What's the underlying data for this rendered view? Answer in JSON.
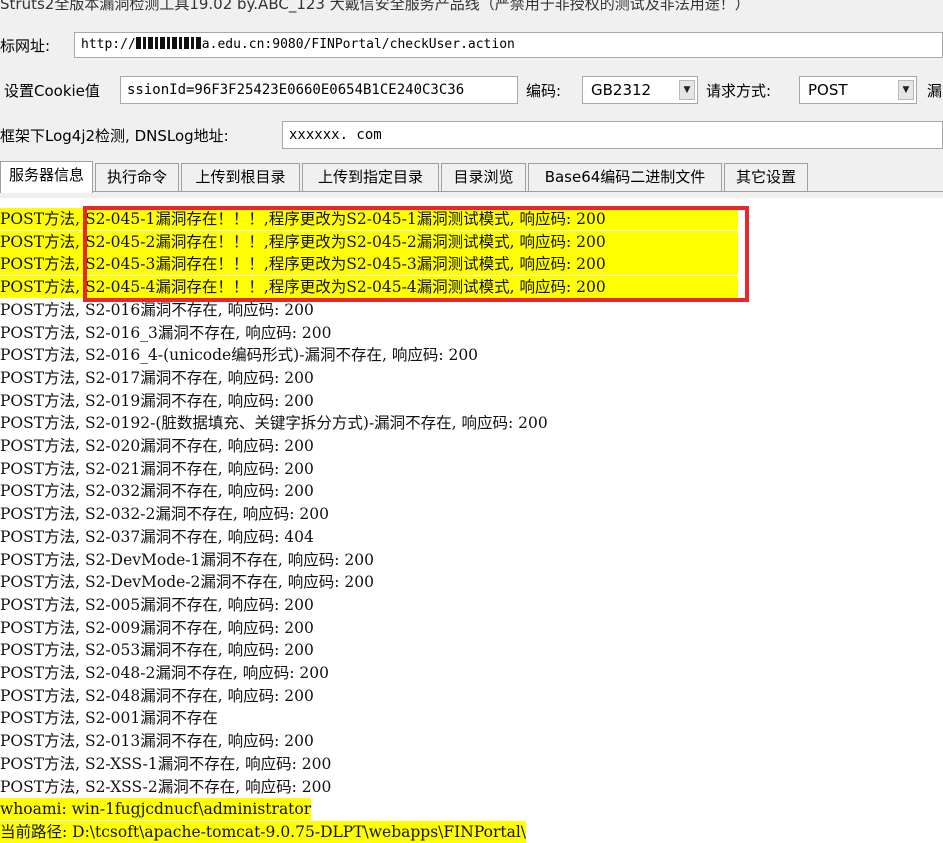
{
  "window": {
    "title": "Struts2全版本漏洞检测工具19.02 by.ABC_123 大戴信安全服务产品线（严禁用于非授权的测试及非法用途！）"
  },
  "form": {
    "url_label": "标网址:",
    "url_prefix": "http://",
    "url_suffix": "a.edu.cn:9080/FINPortal/checkUser.action",
    "cookie_label": "设置Cookie值",
    "cookie_value": "ssionId=96F3F25423E0660E0654B1CE240C3C36",
    "encoding_label": "编码:",
    "encoding_value": "GB2312",
    "method_label": "请求方式:",
    "method_value": "POST",
    "truncated_label": "漏",
    "dnslog_label": "框架下Log4j2检测, DNSLog地址:",
    "dnslog_value": "xxxxxx. com"
  },
  "tabs": [
    {
      "label": "服务器信息"
    },
    {
      "label": "执行命令"
    },
    {
      "label": "上传到根目录"
    },
    {
      "label": "上传到指定目录"
    },
    {
      "label": "目录浏览"
    },
    {
      "label": "Base64编码二进制文件"
    },
    {
      "label": "其它设置"
    }
  ],
  "log": [
    {
      "text": "POST方法, S2-045-1漏洞存在！！！,程序更改为S2-045-1漏洞测试模式, 响应码: 200",
      "highlight": true
    },
    {
      "text": "POST方法, S2-045-2漏洞存在！！！,程序更改为S2-045-2漏洞测试模式, 响应码: 200",
      "highlight": true
    },
    {
      "text": "POST方法, S2-045-3漏洞存在！！！,程序更改为S2-045-3漏洞测试模式, 响应码: 200",
      "highlight": true
    },
    {
      "text": "POST方法, S2-045-4漏洞存在！！！,程序更改为S2-045-4漏洞测试模式, 响应码: 200",
      "highlight": true
    },
    {
      "text": "POST方法, S2-016漏洞不存在, 响应码: 200",
      "highlight": false
    },
    {
      "text": "POST方法, S2-016_3漏洞不存在, 响应码: 200",
      "highlight": false
    },
    {
      "text": "POST方法, S2-016_4-(unicode编码形式)-漏洞不存在, 响应码: 200",
      "highlight": false
    },
    {
      "text": "POST方法, S2-017漏洞不存在, 响应码: 200",
      "highlight": false
    },
    {
      "text": "POST方法, S2-019漏洞不存在, 响应码: 200",
      "highlight": false
    },
    {
      "text": "POST方法, S2-0192-(脏数据填充、关键字拆分方式)-漏洞不存在, 响应码: 200",
      "highlight": false
    },
    {
      "text": "POST方法, S2-020漏洞不存在, 响应码: 200",
      "highlight": false
    },
    {
      "text": "POST方法, S2-021漏洞不存在, 响应码: 200",
      "highlight": false
    },
    {
      "text": "POST方法, S2-032漏洞不存在, 响应码: 200",
      "highlight": false
    },
    {
      "text": "POST方法, S2-032-2漏洞不存在, 响应码: 200",
      "highlight": false
    },
    {
      "text": "POST方法, S2-037漏洞不存在, 响应码: 404",
      "highlight": false
    },
    {
      "text": "POST方法, S2-DevMode-1漏洞不存在, 响应码: 200",
      "highlight": false
    },
    {
      "text": "POST方法, S2-DevMode-2漏洞不存在, 响应码: 200",
      "highlight": false
    },
    {
      "text": "POST方法, S2-005漏洞不存在, 响应码: 200",
      "highlight": false
    },
    {
      "text": "POST方法, S2-009漏洞不存在, 响应码: 200",
      "highlight": false
    },
    {
      "text": "POST方法, S2-053漏洞不存在, 响应码: 200",
      "highlight": false
    },
    {
      "text": "POST方法, S2-048-2漏洞不存在, 响应码: 200",
      "highlight": false
    },
    {
      "text": "POST方法, S2-048漏洞不存在, 响应码: 200",
      "highlight": false
    },
    {
      "text": "POST方法, S2-001漏洞不存在",
      "highlight": false
    },
    {
      "text": "POST方法, S2-013漏洞不存在, 响应码: 200",
      "highlight": false
    },
    {
      "text": "POST方法, S2-XSS-1漏洞不存在, 响应码: 200",
      "highlight": false
    },
    {
      "text": "POST方法, S2-XSS-2漏洞不存在, 响应码: 200",
      "highlight": false
    },
    {
      "text": "whoami: win-1fugjcdnucf\\administrator",
      "highlight": true
    },
    {
      "text": "当前路径: D:\\tcsoft\\apache-tomcat-9.0.75-DLPT\\webapps\\FINPortal\\",
      "highlight": true
    }
  ],
  "colors": {
    "highlight": "#ffff00",
    "annotation_box": "#e8272a",
    "panel_bg": "#f0f0f0"
  }
}
